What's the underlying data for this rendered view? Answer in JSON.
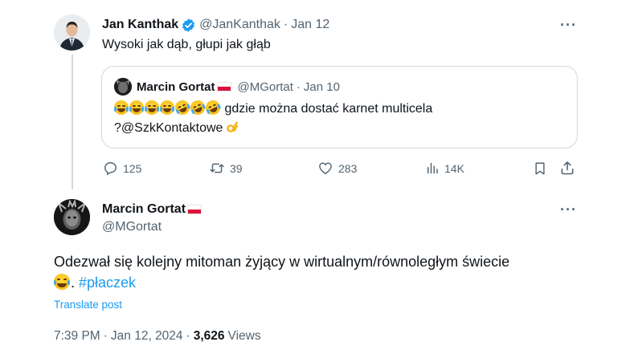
{
  "tweet": {
    "author_name": "Jan Kanthak",
    "handle": "@JanKanthak",
    "separator": "·",
    "date": "Jan 12",
    "text": "Wysoki jak dąb, głupi jak głąb",
    "more_icon": "more-dots-icon",
    "verified_color": "#1d9bf0"
  },
  "quoted": {
    "author_name": "Marcin Gortat",
    "handle": "@MGortat",
    "separator": "·",
    "date": "Jan 10",
    "text_line1": "gdzie można dostać karnet multicela",
    "text_line2": "?@SzkKontaktowe",
    "emoji_line1": [
      "joy",
      "joy",
      "joy",
      "joy",
      "rofl",
      "rofl",
      "rofl"
    ],
    "emoji_line2": "ok-hand"
  },
  "actions": {
    "replies": "125",
    "reposts": "39",
    "likes": "283",
    "views": "14K"
  },
  "reply": {
    "author_name": "Marcin Gortat",
    "handle": "@MGortat",
    "text_main": "Odezwał się kolejny mitoman żyjący w wirtualnym/równoległym świecie",
    "text_after_emoji": ". ",
    "hashtag": "#płaczek",
    "emoji": "joy",
    "translate": "Translate post",
    "time": "7:39 PM",
    "separator": "·",
    "date": "Jan 12, 2024",
    "separator2": "·",
    "views_count": "3,626",
    "views_label": "Views"
  },
  "colors": {
    "text": "#0f1419",
    "muted": "#536471",
    "accent": "#1d9bf0",
    "border": "#cfd9de"
  }
}
